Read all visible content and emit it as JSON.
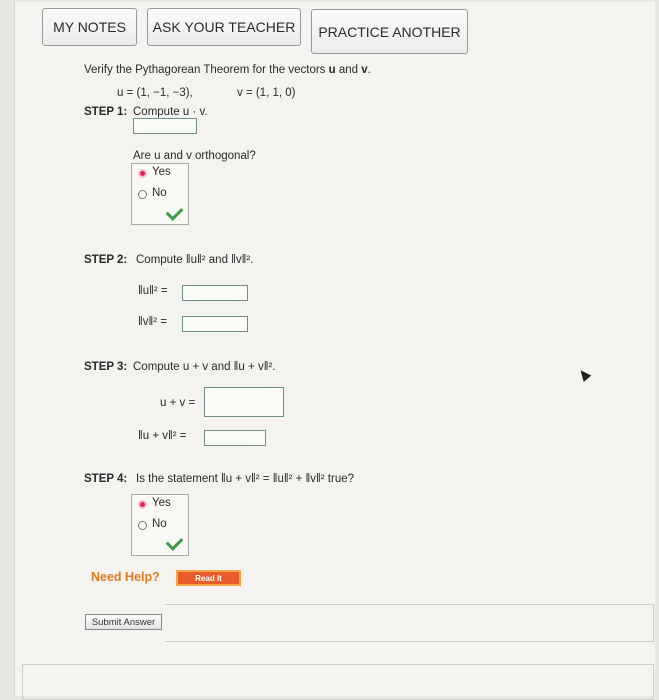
{
  "buttons": {
    "my_notes": "MY NOTES",
    "ask_teacher": "ASK YOUR TEACHER",
    "practice": "PRACTICE ANOTHER"
  },
  "problem": {
    "intro": "Verify the Pythagorean Theorem for the vectors",
    "u_sym": "u",
    "and": "and",
    "v_sym": "v",
    "period": ".",
    "u_def": "u = (1, −1, −3),",
    "v_def": "v = (1, 1, 0)"
  },
  "step1": {
    "label": "STEP 1:",
    "text": "Compute u · v.",
    "question": "Are u and v orthogonal?",
    "options": [
      "Yes",
      "No"
    ],
    "selected": "Yes"
  },
  "step2": {
    "label": "STEP 2:",
    "text": "Compute ‖u‖² and ‖v‖².",
    "u_norm": "‖u‖² =",
    "v_norm": "‖v‖² ="
  },
  "step3": {
    "label": "STEP 3:",
    "text": "Compute u + v and ‖u + v‖².",
    "sum": "u + v =",
    "sum_norm": "‖u + v‖² ="
  },
  "step4": {
    "label": "STEP 4:",
    "text": "Is the statement ‖u + v‖² = ‖u‖² + ‖v‖² true?",
    "options": [
      "Yes",
      "No"
    ],
    "selected": "Yes"
  },
  "help": {
    "label": "Need Help?",
    "read_it": "Read It"
  },
  "submit_label": "Submit Answer",
  "colors": {
    "radio_selected": "#e0205a",
    "check": "#3f9a45",
    "help": "#e07b1e",
    "read_it": "#e85b2a"
  }
}
